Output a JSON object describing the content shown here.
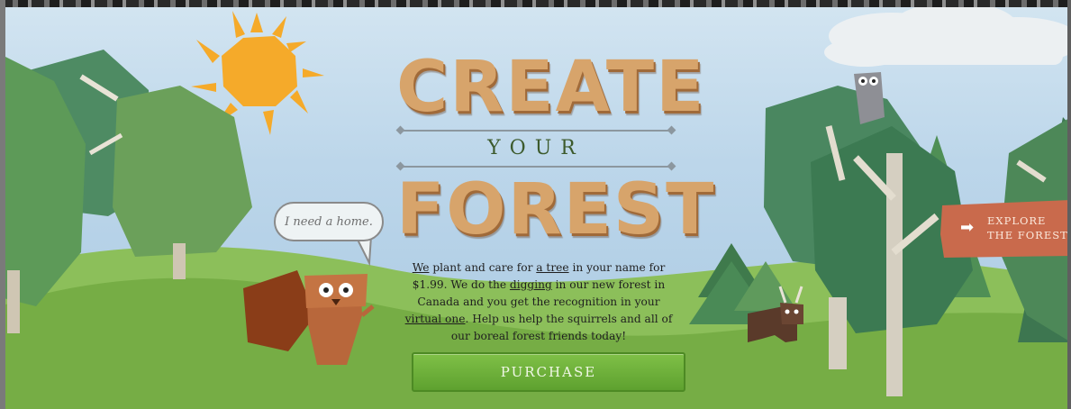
{
  "hero": {
    "title_top": "CREATE",
    "title_middle": "YOUR",
    "title_bottom": "FOREST",
    "description": {
      "p1": "We",
      "p2": " plant and care for ",
      "p3": "a tree",
      "p4": " in your name for $1.99. We do the ",
      "p5": "digging",
      "p6": " in our new forest in Canada and you get the recognition in your ",
      "p7": "virtual one",
      "p8": ". Help us help the squirrels and all of our boreal forest friends today!"
    },
    "purchase_label": "PURCHASE"
  },
  "speech_bubble": {
    "text": "I need a home."
  },
  "explore_button": {
    "line1": "EXPLORE",
    "line2": "THE FOREST"
  },
  "colors": {
    "sky": "#bcd6ea",
    "hill_green": "#7fb24a",
    "tree_green": "#4f8a5a",
    "purchase_green": "#6aad37",
    "explore_orange": "#c96a4c",
    "sun_orange": "#f5aa2a",
    "title_wood": "#d7a46b"
  },
  "icons": [
    "sun-icon",
    "cloud-icon",
    "squirrel-icon",
    "owl-icon",
    "bear-icon",
    "arrow-right-icon"
  ]
}
